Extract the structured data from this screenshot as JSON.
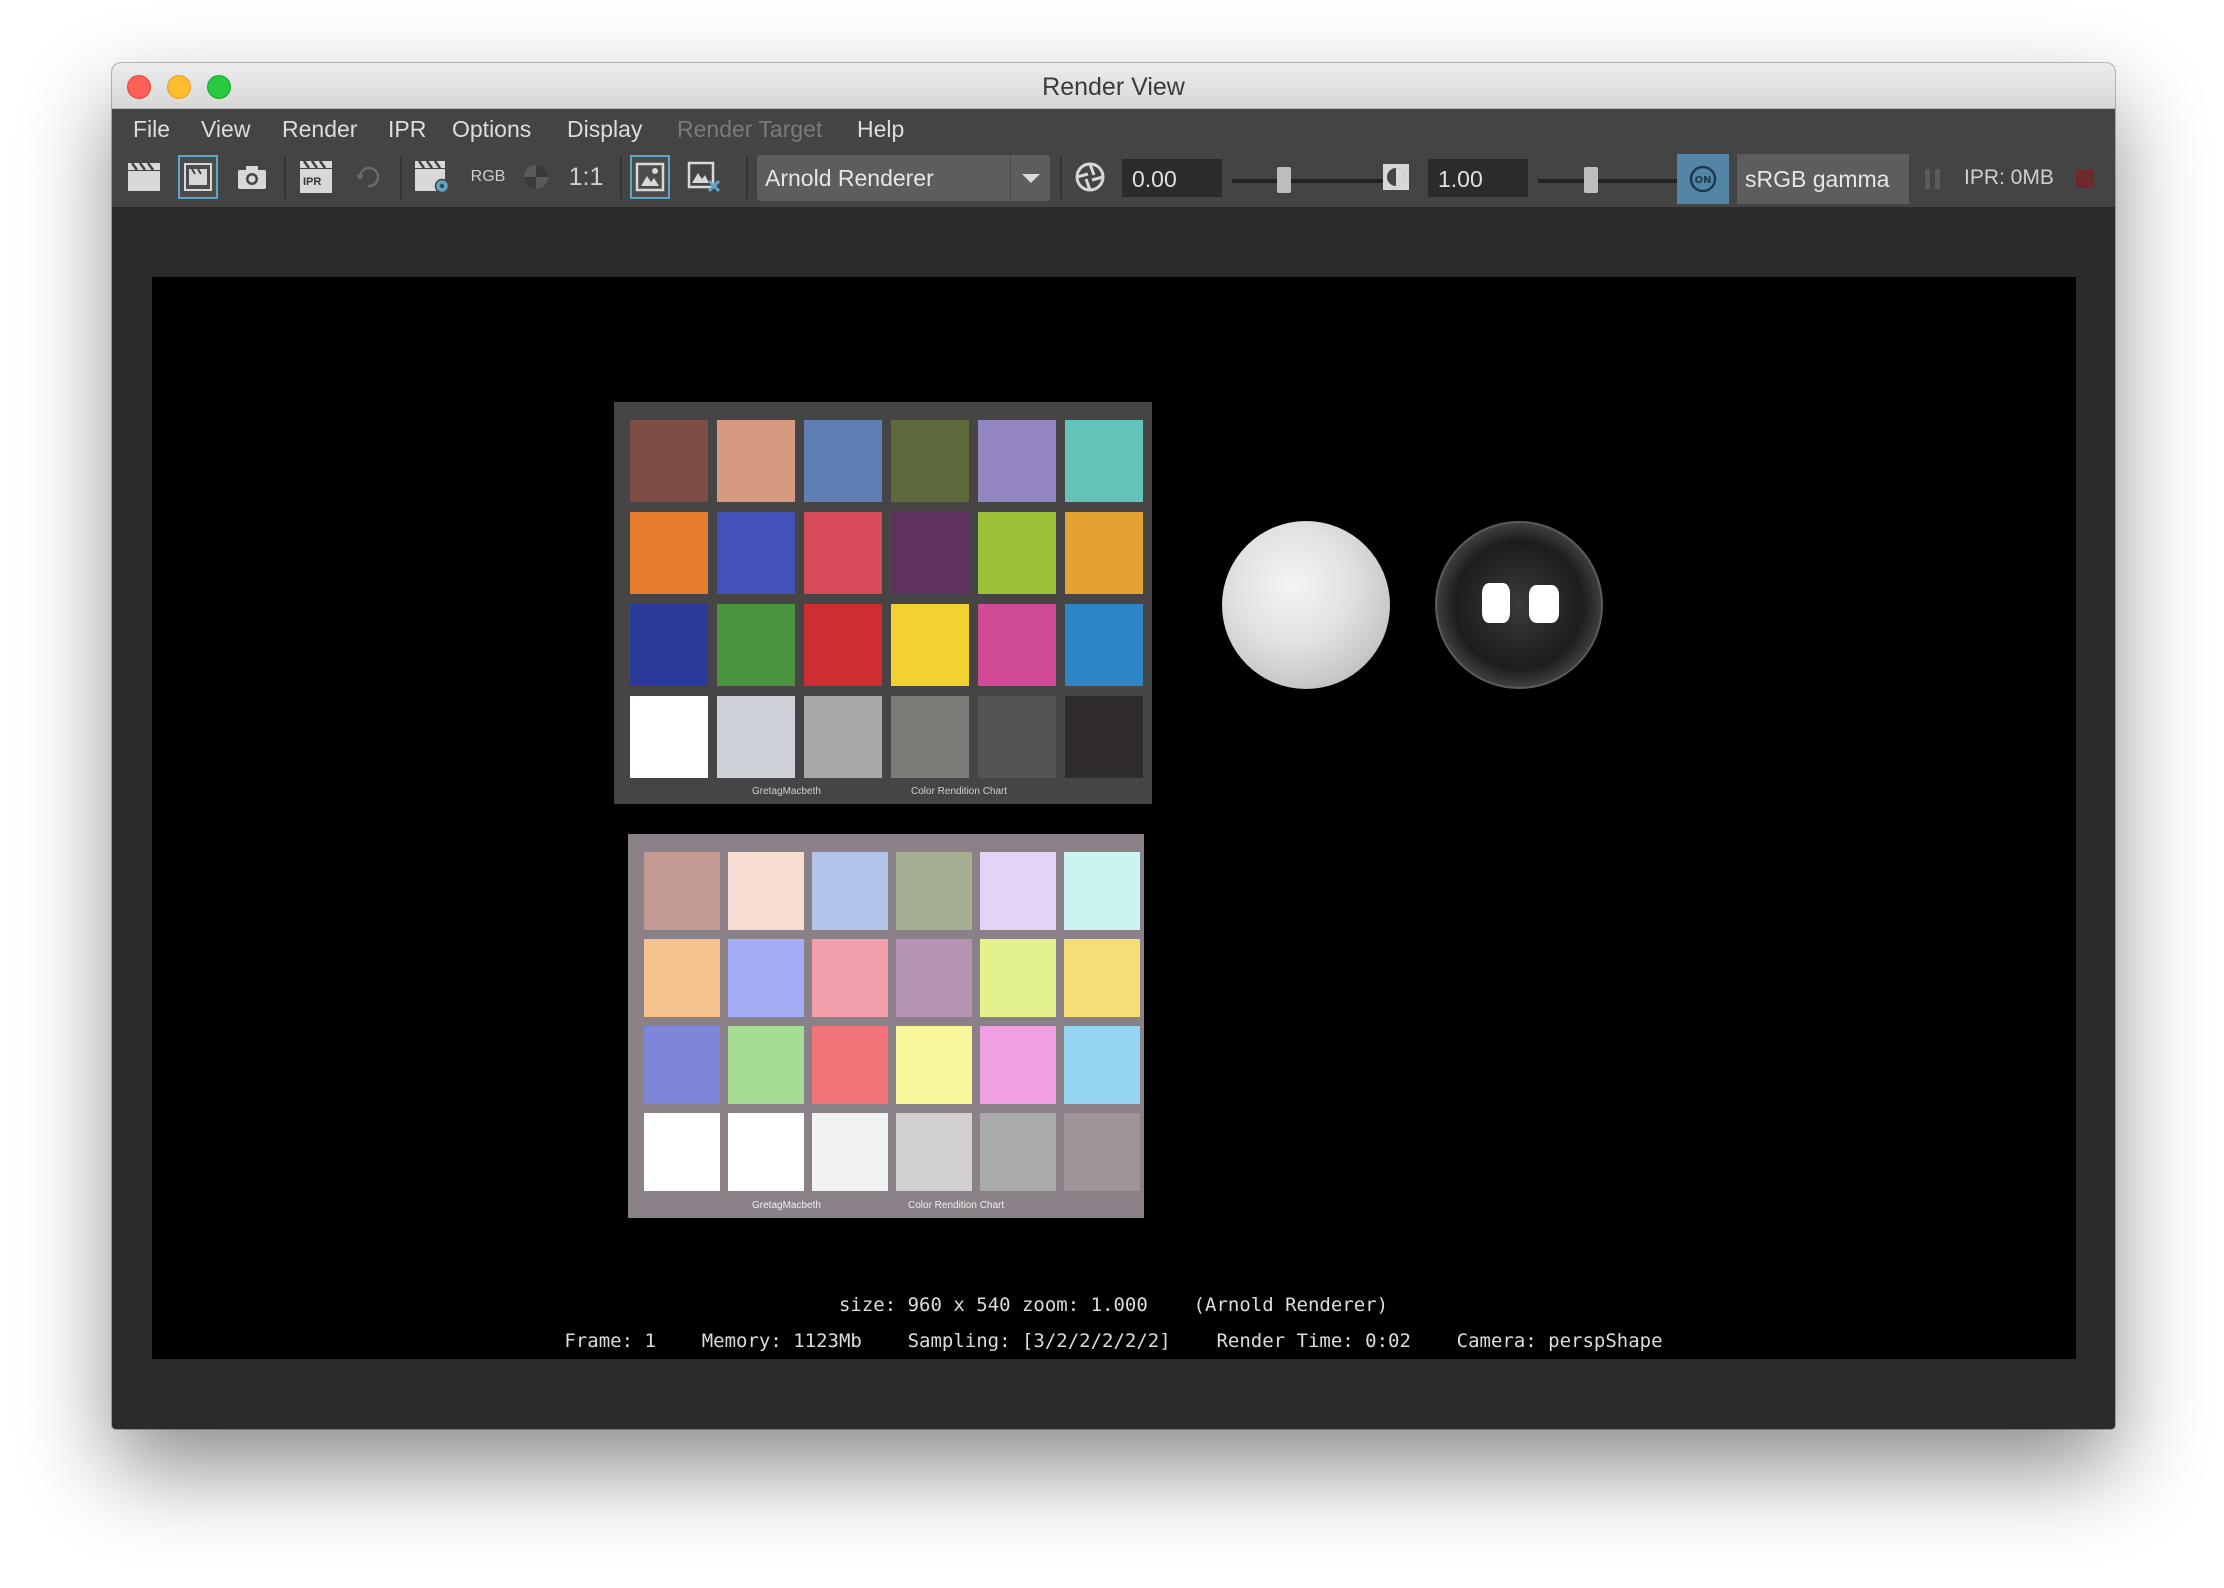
{
  "window": {
    "title": "Render View"
  },
  "menu": {
    "items": [
      {
        "label": "File",
        "enabled": true
      },
      {
        "label": "View",
        "enabled": true
      },
      {
        "label": "Render",
        "enabled": true
      },
      {
        "label": "IPR",
        "enabled": true
      },
      {
        "label": "Options",
        "enabled": true
      },
      {
        "label": "Display",
        "enabled": true
      },
      {
        "label": "Render Target",
        "enabled": false
      },
      {
        "label": "Help",
        "enabled": true
      }
    ]
  },
  "toolbar": {
    "rgb_label": "RGB",
    "real_size_label": "1:1",
    "ipr_label": "IPR",
    "renderer": "Arnold Renderer",
    "exposure": "0.00",
    "gamma": "1.00",
    "color_management_toggle": "ON",
    "color_space": "sRGB gamma",
    "ipr_memory": "IPR: 0MB"
  },
  "render": {
    "chart_top": {
      "caption_left": "GretagMacbeth",
      "caption_right": "Color Rendition Chart",
      "patches": [
        "#7d4e45",
        "#d59a80",
        "#5f7fb5",
        "#5d6b3c",
        "#9385c0",
        "#62c3b9",
        "#e57c2e",
        "#4352b9",
        "#d64a59",
        "#5f315f",
        "#9cc23a",
        "#e4a230",
        "#2a3a9a",
        "#4a9440",
        "#ce2e2f",
        "#f1d231",
        "#d14b96",
        "#2e85c6",
        "#ffffff",
        "#cfd1d9",
        "#a8a8a8",
        "#7b7d79",
        "#545454",
        "#2f2b2e"
      ]
    },
    "chart_bottom": {
      "caption_left": "GretagMacbeth",
      "caption_right": "Color Rendition Chart",
      "patches": [
        "#c29a93",
        "#f7ddd4",
        "#b2c4ea",
        "#a6af91",
        "#e1d4f4",
        "#ccf3f1",
        "#f6c38f",
        "#a6acf3",
        "#f39eab",
        "#b694b4",
        "#e4f28e",
        "#f5de75",
        "#7f85d8",
        "#a4dc93",
        "#f27479",
        "#f8f69a",
        "#ef9fe2",
        "#96d5f2",
        "#ffffff",
        "#ffffff",
        "#f1f2f4",
        "#cfd0cf",
        "#a9aaab",
        "#9e9398"
      ]
    }
  },
  "status": {
    "line1": "size: 960 x 540 zoom: 1.000    (Arnold Renderer)",
    "line2": "Frame: 1    Memory: 1123Mb    Sampling: [3/2/2/2/2/2]    Render Time: 0:02    Camera: perspShape"
  }
}
